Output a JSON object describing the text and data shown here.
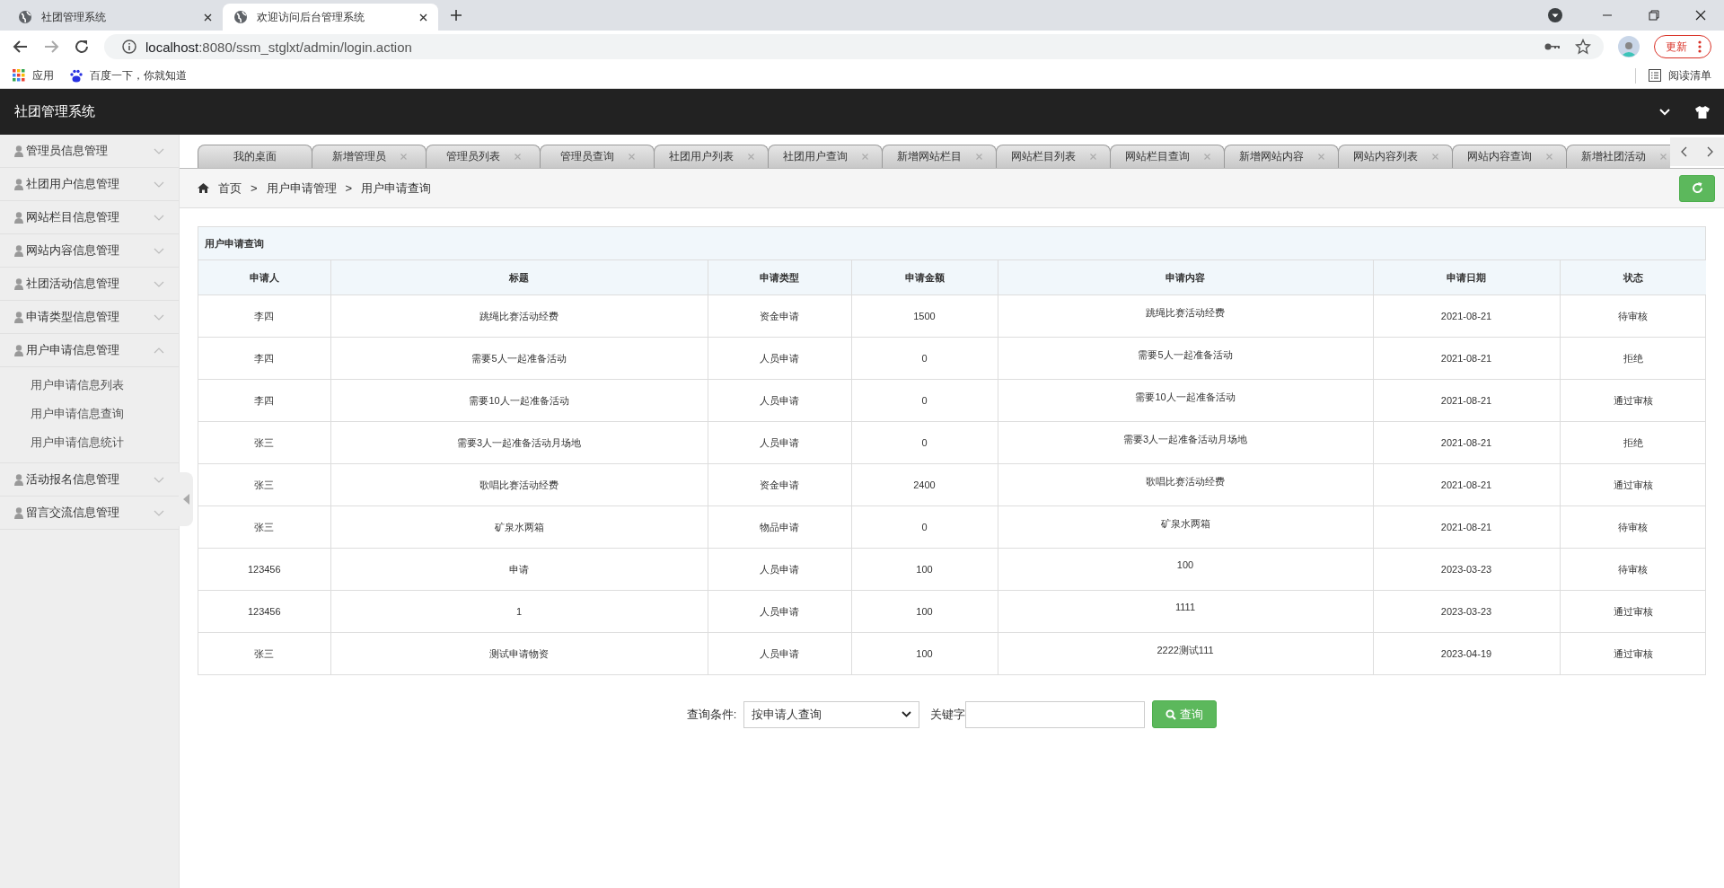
{
  "browser": {
    "tabs": [
      {
        "title": "社团管理系统",
        "selected": false
      },
      {
        "title": "欢迎访问后台管理系统",
        "selected": true
      }
    ],
    "url_host": "localhost",
    "url_rest": ":8080/ssm_stglxt/admin/login.action",
    "update_label": "更新",
    "bookmarks": [
      {
        "label": "应用",
        "kind": "apps"
      },
      {
        "label": "百度一下，你就知道",
        "kind": "paw"
      }
    ],
    "reading_list": "阅读清单"
  },
  "app": {
    "title": "社团管理系统"
  },
  "sidebar": {
    "items": [
      {
        "label": "管理员信息管理",
        "expanded": false
      },
      {
        "label": "社团用户信息管理",
        "expanded": false
      },
      {
        "label": "网站栏目信息管理",
        "expanded": false
      },
      {
        "label": "网站内容信息管理",
        "expanded": false
      },
      {
        "label": "社团活动信息管理",
        "expanded": false
      },
      {
        "label": "申请类型信息管理",
        "expanded": false
      },
      {
        "label": "用户申请信息管理",
        "expanded": true,
        "children": [
          "用户申请信息列表",
          "用户申请信息查询",
          "用户申请信息统计"
        ]
      },
      {
        "label": "活动报名信息管理",
        "expanded": false
      },
      {
        "label": "留言交流信息管理",
        "expanded": false
      }
    ]
  },
  "tabs": [
    {
      "label": "我的桌面",
      "closable": false
    },
    {
      "label": "新增管理员",
      "closable": true
    },
    {
      "label": "管理员列表",
      "closable": true
    },
    {
      "label": "管理员查询",
      "closable": true
    },
    {
      "label": "社团用户列表",
      "closable": true
    },
    {
      "label": "社团用户查询",
      "closable": true
    },
    {
      "label": "新增网站栏目",
      "closable": true
    },
    {
      "label": "网站栏目列表",
      "closable": true
    },
    {
      "label": "网站栏目查询",
      "closable": true
    },
    {
      "label": "新增网站内容",
      "closable": true
    },
    {
      "label": "网站内容列表",
      "closable": true
    },
    {
      "label": "网站内容查询",
      "closable": true
    },
    {
      "label": "新增社团活动",
      "closable": true
    }
  ],
  "breadcrumb": [
    "首页",
    "用户申请管理",
    "用户申请查询"
  ],
  "breadcrumb_separators": [
    ">",
    ">"
  ],
  "table": {
    "title": "用户申请查询",
    "columns": [
      "申请人",
      "标题",
      "申请类型",
      "申请金额",
      "申请内容",
      "申请日期",
      "状态"
    ],
    "rows": [
      [
        "李四",
        "跳绳比赛活动经费",
        "资金申请",
        "1500",
        "跳绳比赛活动经费",
        "2021-08-21",
        "待审核"
      ],
      [
        "李四",
        "需要5人一起准备活动",
        "人员申请",
        "0",
        "需要5人一起准备活动",
        "2021-08-21",
        "拒绝"
      ],
      [
        "李四",
        "需要10人一起准备活动",
        "人员申请",
        "0",
        "需要10人一起准备活动",
        "2021-08-21",
        "通过审核"
      ],
      [
        "张三",
        "需要3人一起准备活动月场地",
        "人员申请",
        "0",
        "需要3人一起准备活动月场地",
        "2021-08-21",
        "拒绝"
      ],
      [
        "张三",
        "歌唱比赛活动经费",
        "资金申请",
        "2400",
        "歌唱比赛活动经费",
        "2021-08-21",
        "通过审核"
      ],
      [
        "张三",
        "矿泉水两箱",
        "物品申请",
        "0",
        "矿泉水两箱",
        "2021-08-21",
        "待审核"
      ],
      [
        "123456",
        "申请",
        "人员申请",
        "100",
        "100",
        "2023-03-23",
        "待审核"
      ],
      [
        "123456",
        "1",
        "人员申请",
        "100",
        "1111",
        "2023-03-23",
        "通过审核"
      ],
      [
        "张三",
        "测试申请物资",
        "人员申请",
        "100",
        "2222测试111",
        "2023-04-19",
        "通过审核"
      ]
    ]
  },
  "search": {
    "condition_label": "查询条件:",
    "condition_value": "按申请人查询",
    "keyword_label": "关键字",
    "button": "查询"
  }
}
